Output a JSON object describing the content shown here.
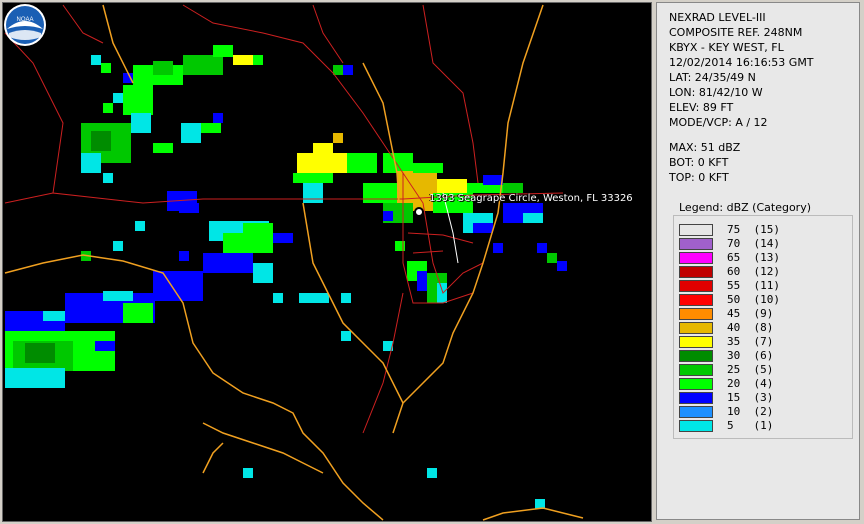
{
  "map": {
    "marker_label": "1393 Seagrape Circle, Weston, FL 33326",
    "colors": {
      "background": "#000000",
      "coastline": "#f0a020",
      "roads": "#cc2020"
    },
    "logo_icon": "noaa-logo-icon",
    "logo_text": "NOAA"
  },
  "info": {
    "lines": [
      "NEXRAD LEVEL-III",
      "COMPOSITE REF. 248NM",
      "KBYX - KEY WEST, FL",
      "12/02/2014 16:16:53 GMT",
      "LAT: 24/35/49 N",
      "LON: 81/42/10 W",
      "ELEV: 89 FT",
      "MODE/VCP: A / 12"
    ],
    "stats": [
      "MAX: 51 dBZ",
      "BOT: 0 KFT",
      "TOP: 0 KFT"
    ]
  },
  "legend": {
    "title": "Legend: dBZ (Category)",
    "items": [
      {
        "label": "75  (15)",
        "color": "#e6e6e6"
      },
      {
        "label": "70  (14)",
        "color": "#a060cc"
      },
      {
        "label": "65  (13)",
        "color": "#ff00ff"
      },
      {
        "label": "60  (12)",
        "color": "#c00000"
      },
      {
        "label": "55  (11)",
        "color": "#e00000"
      },
      {
        "label": "50  (10)",
        "color": "#ff0000"
      },
      {
        "label": "45  (9)",
        "color": "#ff8c00"
      },
      {
        "label": "40  (8)",
        "color": "#e6b800"
      },
      {
        "label": "35  (7)",
        "color": "#ffff00"
      },
      {
        "label": "30  (6)",
        "color": "#008c00"
      },
      {
        "label": "25  (5)",
        "color": "#00c800"
      },
      {
        "label": "20  (4)",
        "color": "#00ff00"
      },
      {
        "label": "15  (3)",
        "color": "#0000ff"
      },
      {
        "label": "10  (2)",
        "color": "#1e90ff"
      },
      {
        "label": "5   (1)",
        "color": "#00e6e6"
      }
    ]
  }
}
